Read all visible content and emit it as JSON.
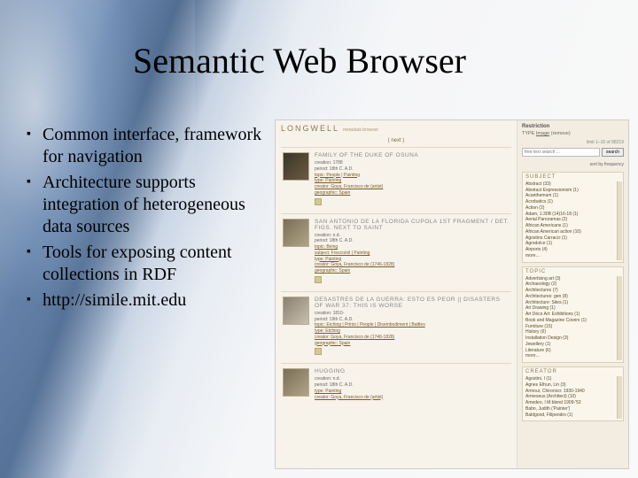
{
  "slide": {
    "title": "Semantic Web Browser",
    "bullets": [
      "Common interface, framework for navigation",
      "Architecture supports integration of heterogeneous data sources",
      "Tools for exposing content collections in RDF",
      "http://simile.mit.edu"
    ]
  },
  "screenshot": {
    "brand": "LONGWELL",
    "brand_sub": "metadata browser",
    "next_label": "( next )",
    "records": [
      {
        "title": "FAMILY OF THE DUKE OF OSUNA",
        "lines": [
          "creation: 1788",
          "period: 18th C. A.D.",
          "topic: People | Painting",
          "type: Painting",
          "creator: Goya, Francisco de (artist)",
          "geographic: Spain"
        ]
      },
      {
        "title": "SAN ANTONIO DE LA FLORIDA CUPOLA 1ST FRAGMENT / DET. FIGS. NEXT TO SAINT",
        "lines": [
          "creation: n.d.",
          "period: 18th C. A.D.",
          "topic: Being",
          "subject: Fresco/oil | Painting",
          "type: Painting",
          "creator: Goya, Francisco de (1746-1828)",
          "geographic: Spain"
        ]
      },
      {
        "title": "DESASTRES DE LA GUERRA: ESTO ES PEOR || DISASTERS OF WAR 37: THIS IS WORSE",
        "lines": [
          "creation: 1810-",
          "period: 19th C. A.D.",
          "topic: Etching | Prints | People | Disembodiment | Battles",
          "type: Etching",
          "creator: Goya, Francisco de (1746-1828)",
          "geographic: Spain"
        ]
      },
      {
        "title": "HUGGING",
        "lines": [
          "creation: n.d.",
          "period: 18th C. A.D.",
          "type: Painting",
          "creator: Goya, Francisco de (artist)"
        ]
      }
    ],
    "sidebar": {
      "restriction_h": "Restriction",
      "type_label": "TYPE",
      "type_value": "Image",
      "type_remove": "(remove)",
      "limit": "limit 1–15 of 88219",
      "search_placeholder": "free text search ...",
      "search_btn": "search",
      "sortby": "sort by frequency",
      "facets": [
        {
          "name": "SUBJECT",
          "items": [
            "Abstract (33)",
            "Abstract Expressionism (1)",
            "Acanthemum (1)",
            "Acrobatics (1)",
            "Action (2)",
            "Adam, 1:30B (14)16-18 (1)",
            "Aerial Panoramas (2)",
            "African Americans (1)",
            "African American action (10)",
            "Agostino Carracci (1)",
            "Agrodolce (1)",
            "Airports (4)",
            "more…"
          ]
        },
        {
          "name": "TOPIC",
          "items": [
            "Advertising art (3)",
            "Archaeology (2)",
            "Architectures (7)",
            "Architectures: gen (8)",
            "Architecture: Sites (1)",
            "Art Drawing (1)",
            "Art Déco Art: Exhibitions (1)",
            "Book and Magazine Covers (1)",
            "Furniture (15)",
            "History (6)",
            "Installation Design (3)",
            "Jewellery (1)",
            "Literature (6)",
            "more…"
          ]
        },
        {
          "name": "CREATOR",
          "items": [
            "Agostini, I (1)",
            "Agnes Ethun, Lin (3)",
            "Armour, Chironico: 1930-1940",
            "Armeseus (Architect) (10)",
            "Amedeo, I M:blend 1909-'52",
            "Babo, Judith ('Painter')",
            "Baldgood, Filipendro (1)"
          ]
        }
      ]
    }
  }
}
